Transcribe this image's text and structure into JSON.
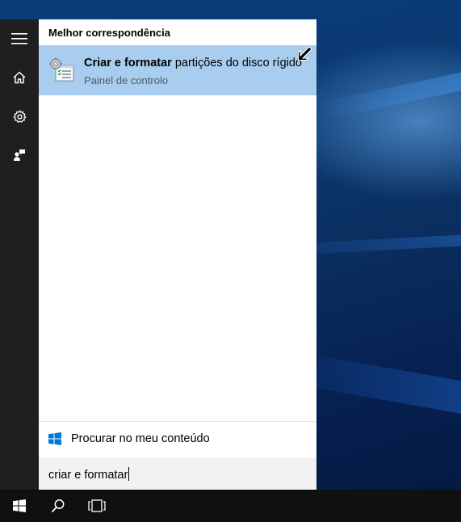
{
  "start_rail": {
    "items": [
      {
        "name": "hamburger-menu-icon"
      },
      {
        "name": "home-icon"
      },
      {
        "name": "settings-gear-icon"
      },
      {
        "name": "feedback-icon"
      }
    ]
  },
  "results": {
    "section_header": "Melhor correspondência",
    "best_match": {
      "title_bold": "Criar e formatar",
      "title_rest": " partições do disco rígido",
      "subtitle": "Painel de controlo",
      "icon": "control-panel-tool-icon"
    },
    "my_stuff_label": "Procurar no meu conteúdo"
  },
  "search": {
    "query": "criar e formatar"
  },
  "taskbar": {
    "items": [
      "start-button",
      "search-button",
      "task-view-button"
    ]
  },
  "colors": {
    "selection": "#a8cdef",
    "rail": "#1f1f1f",
    "taskbar": "#101010",
    "windows_blue": "#0078d7"
  }
}
